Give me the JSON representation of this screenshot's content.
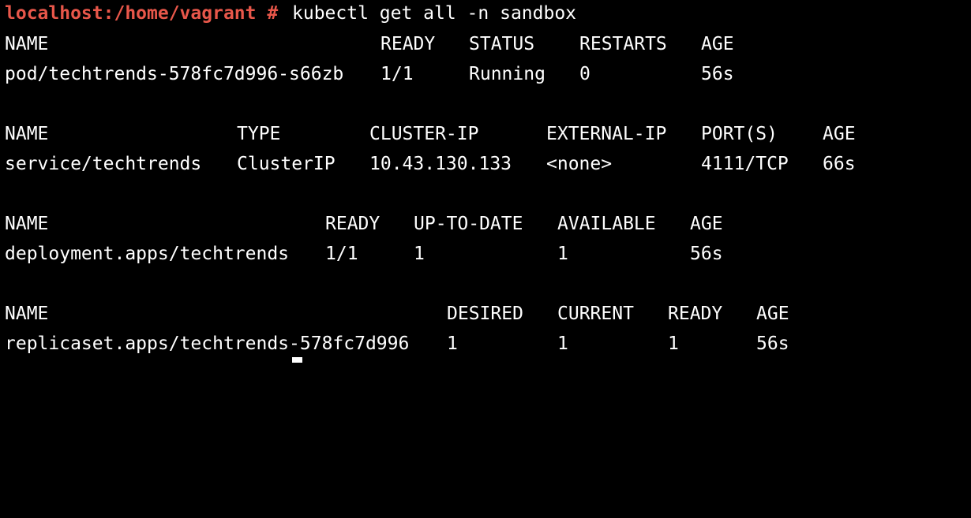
{
  "prompt": {
    "text": "localhost:/home/vagrant #",
    "command": "kubectl get all -n sandbox",
    "color": "#e8574a"
  },
  "pods": {
    "headers": [
      "NAME",
      "READY",
      "STATUS",
      "RESTARTS",
      "AGE"
    ],
    "rows": [
      [
        "pod/techtrends-578fc7d996-s66zb",
        "1/1",
        "Running",
        "0",
        "56s"
      ]
    ]
  },
  "services": {
    "headers": [
      "NAME",
      "TYPE",
      "CLUSTER-IP",
      "EXTERNAL-IP",
      "PORT(S)",
      "AGE"
    ],
    "rows": [
      [
        "service/techtrends",
        "ClusterIP",
        "10.43.130.133",
        "<none>",
        "4111/TCP",
        "66s"
      ]
    ]
  },
  "deployments": {
    "headers": [
      "NAME",
      "READY",
      "UP-TO-DATE",
      "AVAILABLE",
      "AGE"
    ],
    "rows": [
      [
        "deployment.apps/techtrends",
        "1/1",
        "1",
        "1",
        "56s"
      ]
    ]
  },
  "replicasets": {
    "headers": [
      "NAME",
      "DESIRED",
      "CURRENT",
      "READY",
      "AGE"
    ],
    "rows": [
      [
        "replicaset.apps/techtrends-578fc7d996",
        "1",
        "1",
        "1",
        "56s"
      ]
    ]
  }
}
